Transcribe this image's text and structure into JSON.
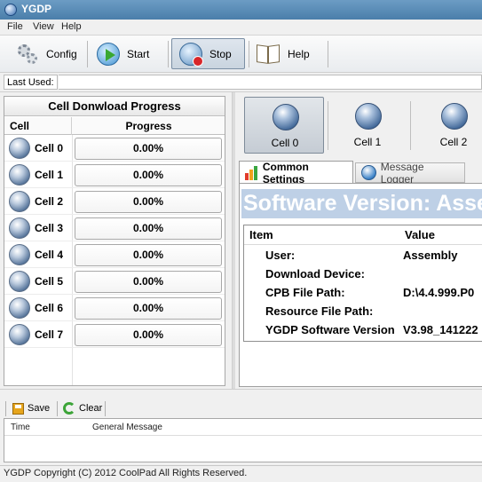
{
  "window": {
    "title": "YGDP"
  },
  "menu": [
    "File",
    "View",
    "Help"
  ],
  "toolbar": {
    "config": "Config",
    "start": "Start",
    "stop": "Stop",
    "help": "Help"
  },
  "last_used": {
    "label": "Last Used:",
    "value": ""
  },
  "download_grid": {
    "title": "Cell Donwload Progress",
    "col_cell": "Cell",
    "col_progress": "Progress",
    "rows": [
      {
        "cell": "Cell 0",
        "progress": "0.00%"
      },
      {
        "cell": "Cell 1",
        "progress": "0.00%"
      },
      {
        "cell": "Cell 2",
        "progress": "0.00%"
      },
      {
        "cell": "Cell 3",
        "progress": "0.00%"
      },
      {
        "cell": "Cell 4",
        "progress": "0.00%"
      },
      {
        "cell": "Cell 5",
        "progress": "0.00%"
      },
      {
        "cell": "Cell 6",
        "progress": "0.00%"
      },
      {
        "cell": "Cell 7",
        "progress": "0.00%"
      }
    ]
  },
  "cell_buttons": [
    "Cell 0",
    "Cell 1",
    "Cell 2"
  ],
  "selected_cell": "Cell 0",
  "tabs": {
    "common_settings": "Common Settings",
    "message_logger": "Message Logger"
  },
  "settings": {
    "banner": "Software Version:  Assembly",
    "col_item": "Item",
    "col_value": "Value",
    "rows": [
      {
        "item": "User:",
        "value": "Assembly"
      },
      {
        "item": "Download Device:",
        "value": ""
      },
      {
        "item": "CPB File Path:",
        "value": "D:\\4.4.999.P0"
      },
      {
        "item": "Resource File Path:",
        "value": ""
      },
      {
        "item": "YGDP Software Version",
        "value": "V3.98_141222"
      }
    ]
  },
  "log": {
    "save": "Save",
    "clear": "Clear",
    "col_time": "Time",
    "col_message": "General Message"
  },
  "status": {
    "text": "YGDP Copyright (C) 2012 CoolPad All Rights Reserved."
  },
  "colors": {
    "titlebar": "#4a7eaa",
    "banner_bg": "#bed0e6",
    "stop_badge": "#d8262a",
    "start_arrow": "#39a832"
  }
}
